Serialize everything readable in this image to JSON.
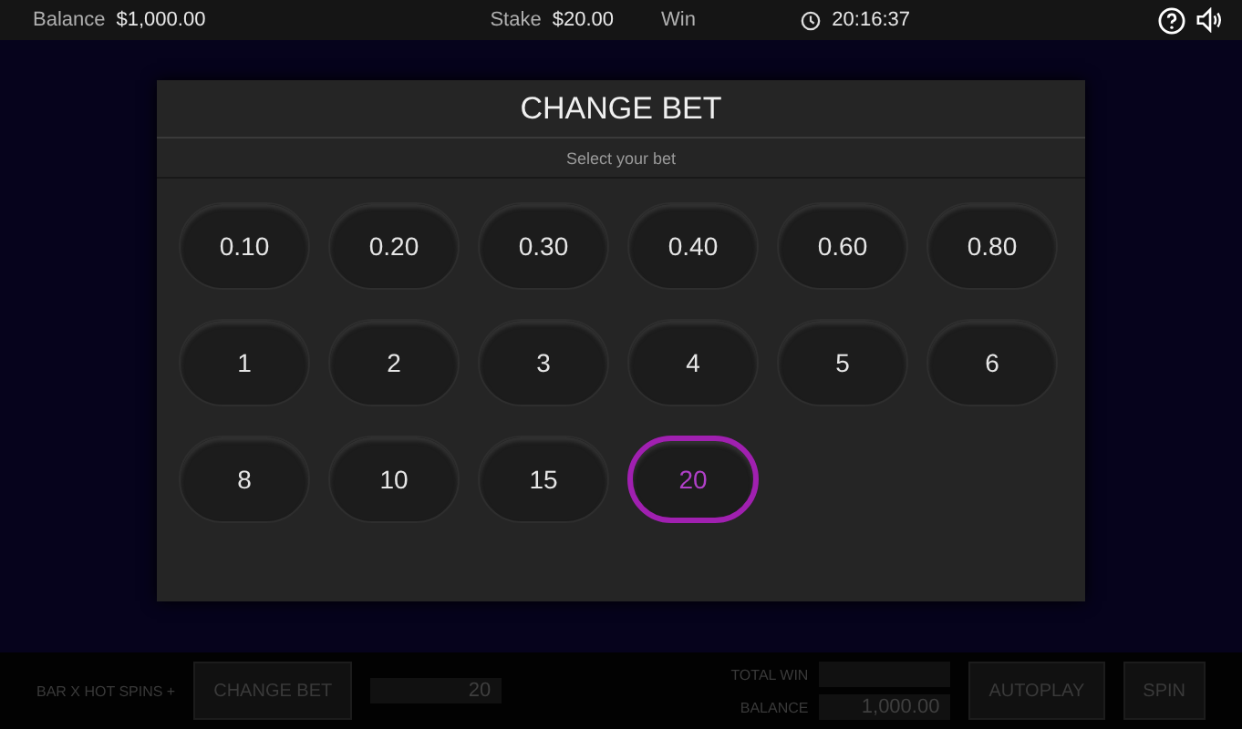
{
  "top_bar": {
    "balance_label": "Balance",
    "balance": "$1,000.00",
    "stake_label": "Stake",
    "stake": "$20.00",
    "win_label": "Win",
    "time": "20:16:37"
  },
  "dialog": {
    "title": "CHANGE BET",
    "subtitle": "Select your bet",
    "bets": [
      {
        "label": "0.10",
        "selected": false
      },
      {
        "label": "0.20",
        "selected": false
      },
      {
        "label": "0.30",
        "selected": false
      },
      {
        "label": "0.40",
        "selected": false
      },
      {
        "label": "0.60",
        "selected": false
      },
      {
        "label": "0.80",
        "selected": false
      },
      {
        "label": "1",
        "selected": false
      },
      {
        "label": "2",
        "selected": false
      },
      {
        "label": "3",
        "selected": false
      },
      {
        "label": "4",
        "selected": false
      },
      {
        "label": "5",
        "selected": false
      },
      {
        "label": "6",
        "selected": false
      },
      {
        "label": "8",
        "selected": false
      },
      {
        "label": "10",
        "selected": false
      },
      {
        "label": "15",
        "selected": false
      },
      {
        "label": "20",
        "selected": true
      }
    ]
  },
  "bottom_bar": {
    "game_name": "BAR X HOT SPINS +",
    "change_bet": "CHANGE BET",
    "bet": "20",
    "total_win_label": "TOTAL WIN",
    "balance_label": "BALANCE",
    "balance": "1,000.00",
    "autoplay": "AUTOPLAY",
    "spin": "SPIN"
  }
}
